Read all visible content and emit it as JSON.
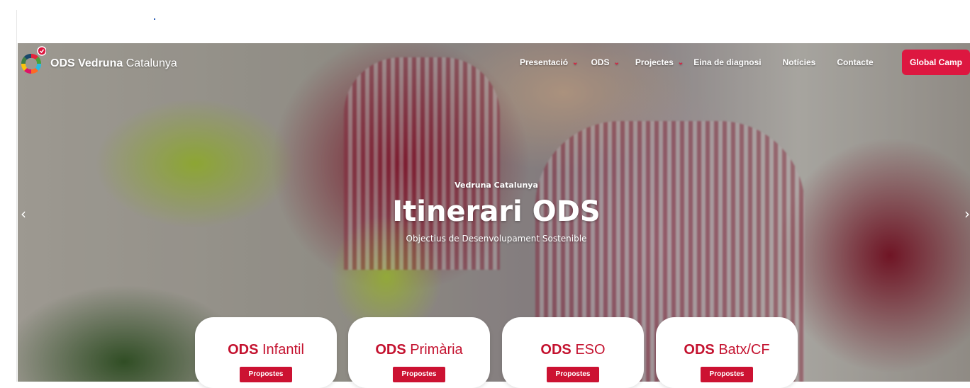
{
  "brand": {
    "bold": "ODS Vedruna",
    "light": " Catalunya"
  },
  "nav": {
    "items": [
      {
        "label": "Presentació",
        "dropdown": true
      },
      {
        "label": "ODS",
        "dropdown": true
      },
      {
        "label": "Projectes",
        "dropdown": true
      },
      {
        "label": "Eina de diagnosi",
        "dropdown": false
      },
      {
        "label": "Notícies",
        "dropdown": false
      },
      {
        "label": "Contacte",
        "dropdown": false
      }
    ],
    "cta_label": "Global Camp"
  },
  "hero": {
    "eyebrow": "Vedruna Catalunya",
    "title": "Itinerari ODS",
    "subtitle": "Objectius de Desenvolupament Sostenible"
  },
  "cards": [
    {
      "bold": "ODS",
      "rest": " Infantil",
      "button": "Propostes"
    },
    {
      "bold": "ODS",
      "rest": " Primària",
      "button": "Propostes"
    },
    {
      "bold": "ODS",
      "rest": " ESO",
      "button": "Propostes"
    },
    {
      "bold": "ODS",
      "rest": " Batx/CF",
      "button": "Propostes"
    }
  ],
  "icons": {
    "prev": "chevron-left-icon",
    "next": "chevron-right-icon",
    "dropdown": "chevron-down-icon",
    "logo": "sdg-wheel-logo"
  },
  "colors": {
    "accent": "#dd1740",
    "card_text": "#c4122f"
  }
}
